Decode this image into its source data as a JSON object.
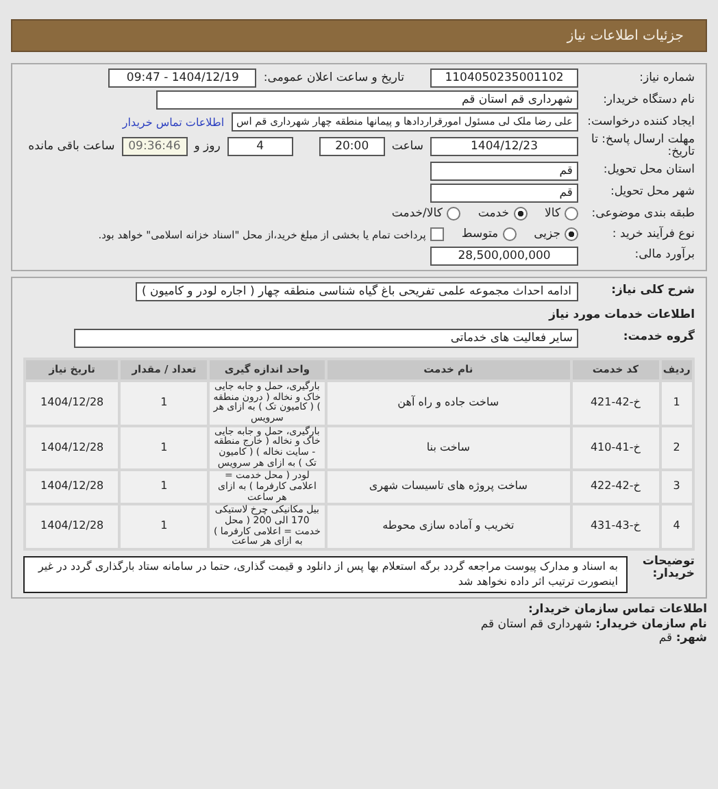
{
  "header": {
    "title": "جزئیات اطلاعات نیاز"
  },
  "need_number": {
    "label": "شماره نیاز:",
    "value": "1104050235001102"
  },
  "announce": {
    "label": "تاریخ و ساعت اعلان عمومی:",
    "value": "1404/12/19 - 09:47"
  },
  "buyer": {
    "label": "نام دستگاه خریدار:",
    "value": "شهرداری قم استان قم"
  },
  "creator": {
    "label": "ایجاد کننده درخواست:",
    "value": "علی رضا ملک لی مسئول امورقراردادها و پیمانها منطقه چهار  شهرداری قم اس",
    "link": "اطلاعات تماس خریدار"
  },
  "deadline": {
    "label": "مهلت ارسال پاسخ: تا تاریخ:",
    "date": "1404/12/23",
    "time_label": "ساعت",
    "time": "20:00",
    "days": "4",
    "days_label": "روز و",
    "remaining": "09:36:46",
    "remaining_label": "ساعت باقی مانده"
  },
  "province": {
    "label": "استان محل تحویل:",
    "value": "قم"
  },
  "city": {
    "label": "شهر محل تحویل:",
    "value": "قم"
  },
  "category": {
    "label": "طبقه بندی موضوعی:",
    "options": [
      {
        "label": "کالا",
        "selected": false
      },
      {
        "label": "خدمت",
        "selected": true
      },
      {
        "label": "کالا/خدمت",
        "selected": false
      }
    ]
  },
  "process": {
    "label": "نوع فرآیند خرید :",
    "options": [
      {
        "label": "جزیی",
        "selected": true
      },
      {
        "label": "متوسط",
        "selected": false
      }
    ],
    "payment": {
      "label": "پرداخت تمام یا بخشی از مبلغ خرید،از محل \"اسناد خزانه اسلامی\" خواهد بود.",
      "checked": false
    }
  },
  "estimate": {
    "label": "برآورد مالی:",
    "value": "28,500,000,000"
  },
  "summary": {
    "label": "شرح کلی نیاز:",
    "value": "ادامه احداث مجموعه علمی تفریحی باغ گیاه شناسی منطقه چهار ( اجاره لودر و کامیون )"
  },
  "services_title": "اطلاعات خدمات مورد نیاز",
  "service_group": {
    "label": "گروه خدمت:",
    "value": "سایر فعالیت های خدماتی"
  },
  "table": {
    "columns": [
      "ردیف",
      "کد خدمت",
      "نام خدمت",
      "واحد اندازه گیری",
      "تعداد / مقدار",
      "تاریخ نیاز"
    ],
    "rows": [
      [
        "1",
        "خ-42-421",
        "ساخت جاده و راه آهن",
        "بارگیری، حمل و جابه جایی خاک و نخاله ( درون منطقه ) ( کامیون تک ) به ازای هر سرویس",
        "1",
        "1404/12/28"
      ],
      [
        "2",
        "خ-41-410",
        "ساخت بنا",
        "بارگیری، حمل و جابه جایی خاک و نخاله ( خارج منطقه - سایت نخاله ) ( کامیون تک ) به ازای هر سرویس",
        "1",
        "1404/12/28"
      ],
      [
        "3",
        "خ-42-422",
        "ساخت پروژه های تاسیسات شهری",
        "لودر ( محل خدمت = اعلامی کارفرما ) به ازای هر ساعت",
        "1",
        "1404/12/28"
      ],
      [
        "4",
        "خ-43-431",
        "تخریب و آماده سازی محوطه",
        "بیل مکانیکی چرخ لاستیکی 170 الی 200 ( محل خدمت = اعلامی کارفرما ) به ازای هر ساعت",
        "1",
        "1404/12/28"
      ]
    ]
  },
  "notes": {
    "label": "توضیحات خریدار:",
    "value": "به اسناد و مدارک پیوست مراجعه گردد برگه استعلام بها پس از دانلود و قیمت گذاری، حتما در سامانه ستاد بارگذاری گردد در غیر اینصورت ترتیب اثر داده نخواهد شد"
  },
  "contact": {
    "title": "اطلاعات تماس سازمان خریدار:",
    "items": [
      {
        "label": "نام سازمان خریدار:",
        "value": "شهرداری قم استان قم"
      },
      {
        "label": "شهر:",
        "value": "قم"
      }
    ]
  }
}
